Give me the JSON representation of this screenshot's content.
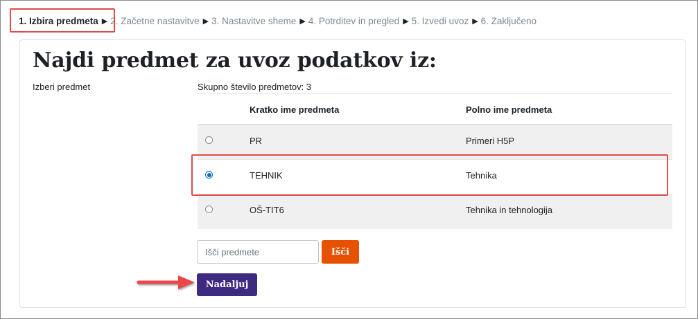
{
  "steps": [
    {
      "label": "1. Izbira predmeta",
      "current": true
    },
    {
      "label": "2. Začetne nastavitve",
      "current": false
    },
    {
      "label": "3. Nastavitve sheme",
      "current": false
    },
    {
      "label": "4. Potrditev in pregled",
      "current": false
    },
    {
      "label": "5. Izvedi uvoz",
      "current": false
    },
    {
      "label": "6. Zaključeno",
      "current": false
    }
  ],
  "step_separator": "▶",
  "heading": "Najdi predmet za uvoz podatkov iz:",
  "select_label": "Izberi predmet",
  "total_label": "Skupno število predmetov: 3",
  "table": {
    "columns": [
      "Kratko ime predmeta",
      "Polno ime predmeta"
    ],
    "rows": [
      {
        "short": "PR",
        "full": "Primeri H5P",
        "selected": false
      },
      {
        "short": "TEHNIK",
        "full": "Tehnika",
        "selected": true
      },
      {
        "short": "OŠ-TIT6",
        "full": "Tehnika in tehnologija",
        "selected": false
      }
    ]
  },
  "search": {
    "placeholder": "Išči predmete",
    "value": "",
    "button_label": "Išči"
  },
  "continue_label": "Nadaljuj",
  "colors": {
    "accent_orange": "#e65100",
    "primary_purple": "#3f2a82",
    "annotation_red": "#e04b4b",
    "radio_blue": "#0f6cbf"
  }
}
